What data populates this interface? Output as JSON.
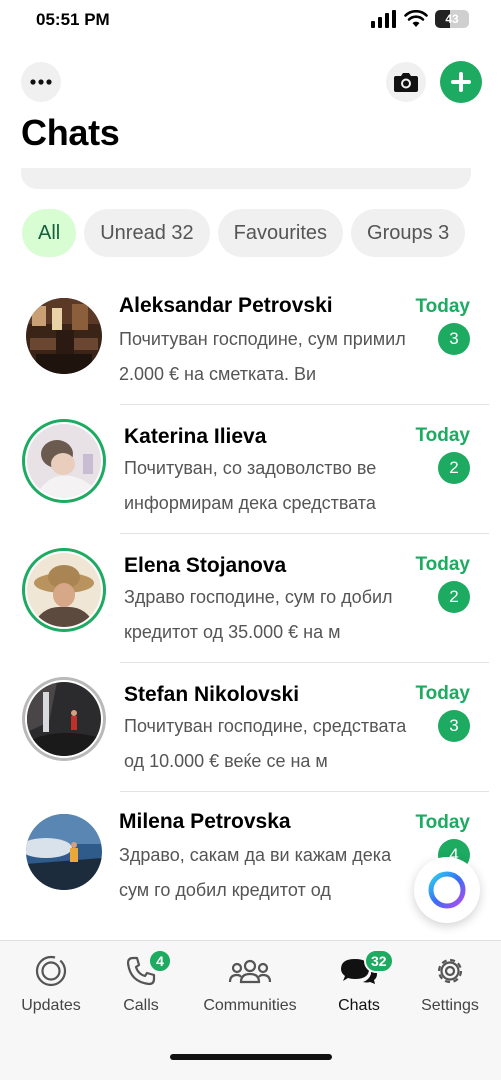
{
  "status_bar": {
    "time": "05:51 PM",
    "battery": "43"
  },
  "header": {
    "title": "Chats"
  },
  "filters": [
    {
      "label": "All",
      "active": true
    },
    {
      "label": "Unread 32",
      "active": false
    },
    {
      "label": "Favourites",
      "active": false
    },
    {
      "label": "Groups 3",
      "active": false
    }
  ],
  "chats": [
    {
      "name": "Aleksandar Petrovski",
      "preview": "Почитуван господине, сум примил 2.000 € на сметката. Ви",
      "time": "Today",
      "unread": "3"
    },
    {
      "name": "Katerina Ilieva",
      "preview": "Почитуван, со задоволство ве информирам дека средствата",
      "time": "Today",
      "unread": "2"
    },
    {
      "name": "Elena Stojanova",
      "preview": "Здраво господине, сум го добил кредитот од 35.000 € на м",
      "time": "Today",
      "unread": "2"
    },
    {
      "name": "Stefan Nikolovski",
      "preview": "Почитуван господине, средствата од 10.000 € веќе се на м",
      "time": "Today",
      "unread": "3"
    },
    {
      "name": "Milena Petrovska",
      "preview": "Здраво, сакам да ви кажам дека сум го добил кредитот од",
      "time": "Today",
      "unread": "4"
    }
  ],
  "tabs": [
    {
      "label": "Updates",
      "icon": "updates-icon"
    },
    {
      "label": "Calls",
      "icon": "phone-icon",
      "badge": "4"
    },
    {
      "label": "Communities",
      "icon": "communities-icon"
    },
    {
      "label": "Chats",
      "icon": "chats-icon",
      "badge": "32"
    },
    {
      "label": "Settings",
      "icon": "gear-icon"
    }
  ],
  "colors": {
    "accent": "#1daa61",
    "active_chip_bg": "#d8fdd2",
    "active_chip_text": "#15603e"
  }
}
